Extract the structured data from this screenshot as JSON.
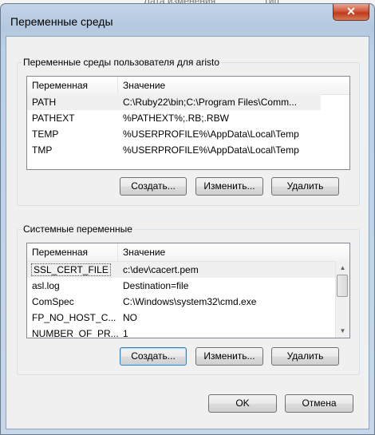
{
  "window": {
    "title": "Переменные среды",
    "close_glyph": "✕"
  },
  "background": {
    "col_date": "Дата изменения",
    "col_type": "Тип"
  },
  "user_vars": {
    "group_label": "Переменные среды пользователя для aristo",
    "columns": [
      "Переменная",
      "Значение"
    ],
    "rows": [
      {
        "name": "PATH",
        "value": "C:\\Ruby22\\bin;C:\\Program Files\\Comm..."
      },
      {
        "name": "PATHEXT",
        "value": "%PATHEXT%;.RB;.RBW"
      },
      {
        "name": "TEMP",
        "value": "%USERPROFILE%\\AppData\\Local\\Temp"
      },
      {
        "name": "TMP",
        "value": "%USERPROFILE%\\AppData\\Local\\Temp"
      }
    ],
    "buttons": {
      "create": "Создать...",
      "edit": "Изменить...",
      "delete": "Удалить"
    }
  },
  "system_vars": {
    "group_label": "Системные переменные",
    "columns": [
      "Переменная",
      "Значение"
    ],
    "rows": [
      {
        "name": "SSL_CERT_FILE",
        "value": "c:\\dev\\cacert.pem"
      },
      {
        "name": "asl.log",
        "value": "Destination=file"
      },
      {
        "name": "ComSpec",
        "value": "C:\\Windows\\system32\\cmd.exe"
      },
      {
        "name": "FP_NO_HOST_C...",
        "value": "NO"
      },
      {
        "name": "NUMBER_OF_PR...",
        "value": "1"
      }
    ],
    "scroll_up_glyph": "▲",
    "scroll_down_glyph": "▼",
    "buttons": {
      "create": "Создать...",
      "edit": "Изменить...",
      "delete": "Удалить"
    }
  },
  "footer": {
    "ok": "OK",
    "cancel": "Отмена"
  }
}
